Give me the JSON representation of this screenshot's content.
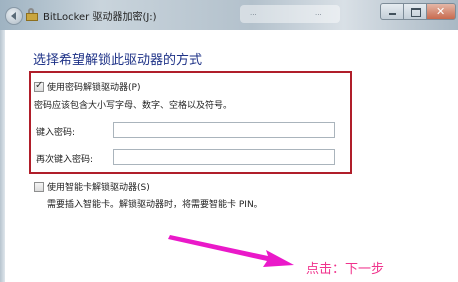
{
  "window": {
    "title": "BitLocker 驱动器加密(J:)",
    "bg_tab_text": "...",
    "bg_tab_text2": "...",
    "accent_color": "#1e3287"
  },
  "heading": "选择希望解锁此驱动器的方式",
  "password_option": {
    "label": "使用密码解锁驱动器(P)",
    "checked": true,
    "description": "密码应该包含大小写字母、数字、空格以及符号。",
    "enter_label": "键入密码:",
    "reenter_label": "再次键入密码:",
    "enter_value": "",
    "reenter_value": ""
  },
  "smartcard_option": {
    "label": "使用智能卡解锁驱动器(S)",
    "checked": false,
    "description": "需要插入智能卡。解锁驱动器时，将需要智能卡 PIN。"
  },
  "annotation": {
    "text": "点击：下一步",
    "color": "#f0328c",
    "highlight_color": "#b01e2a"
  }
}
